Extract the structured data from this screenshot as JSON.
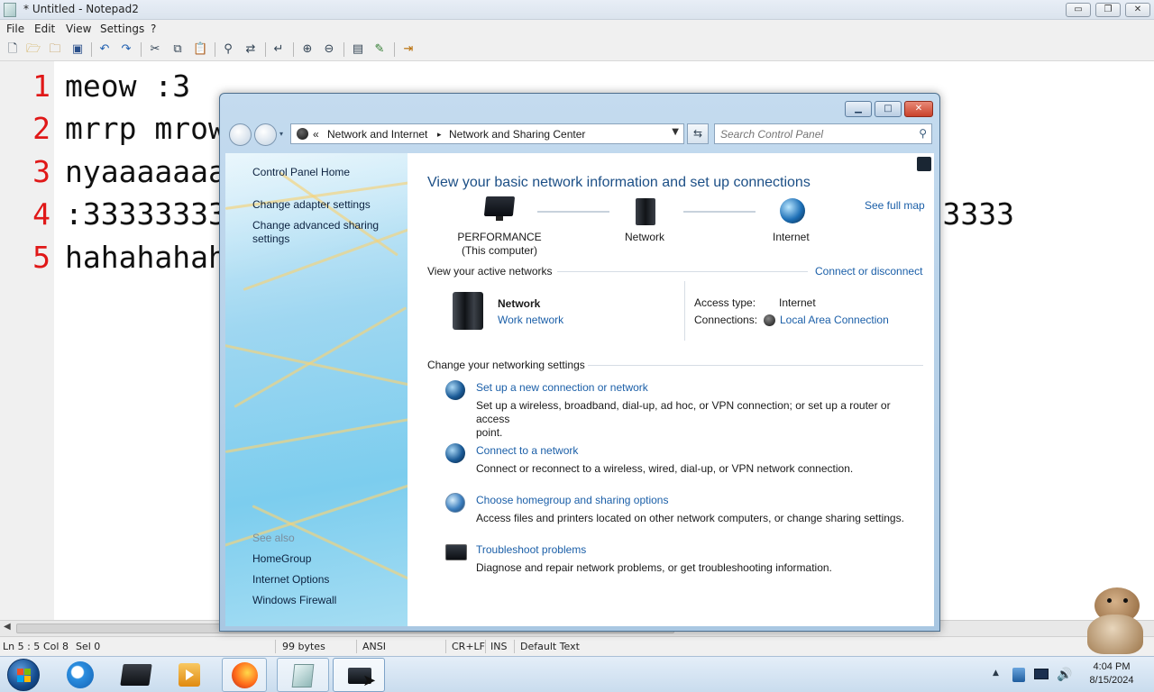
{
  "notepad": {
    "title": "* Untitled - Notepad2",
    "window_buttons": [
      "▭",
      "❐",
      "✕"
    ],
    "menu": [
      "File",
      "Edit",
      "View",
      "Settings",
      "?"
    ],
    "line_numbers": [
      "1",
      "2",
      "3",
      "4",
      "5"
    ],
    "lines": [
      "meow :3",
      "mrrp mrow",
      "nyaaaaaaaaaaa",
      ":3333333333333333333333333333333333333333333333333333",
      "hahahahahaha"
    ],
    "status": {
      "position": "Ln 5 : 5",
      "col": "Col 8",
      "sel": "Sel 0",
      "size": "99 bytes",
      "encoding": "ANSI",
      "eol": "CR+LF",
      "ins": "INS",
      "scheme": "Default Text"
    }
  },
  "control_panel": {
    "breadcrumb": {
      "chevrons": "«",
      "item1": "Network and Internet",
      "sep": "▸",
      "item2": "Network and Sharing Center"
    },
    "search_placeholder": "Search Control Panel",
    "left": {
      "home": "Control Panel Home",
      "adapter": "Change adapter settings",
      "advanced_line1": "Change advanced sharing",
      "advanced_line2": "settings",
      "see_also": "See also",
      "homegroup": "HomeGroup",
      "internet_options": "Internet Options",
      "firewall": "Windows Firewall"
    },
    "main": {
      "heading": "View your basic network information and set up connections",
      "see_full_map": "See full map",
      "map": {
        "computer_line1": "PERFORMANCE",
        "computer_line2": "(This computer)",
        "network": "Network",
        "internet": "Internet"
      },
      "active_networks_label": "View your active networks",
      "connect_or_disconnect": "Connect or disconnect",
      "active": {
        "name": "Network",
        "type": "Work network",
        "access_label": "Access type:",
        "access_value": "Internet",
        "connections_label": "Connections:",
        "connections_value": "Local Area Connection"
      },
      "change_label": "Change your networking settings",
      "tasks": [
        {
          "title": "Set up a new connection or network",
          "desc1": "Set up a wireless, broadband, dial-up, ad hoc, or VPN connection; or set up a router or access",
          "desc2": "point."
        },
        {
          "title": "Connect to a network",
          "desc1": "Connect or reconnect to a wireless, wired, dial-up, or VPN network connection."
        },
        {
          "title": "Choose homegroup and sharing options",
          "desc1": "Access files and printers located on other network computers, or change sharing settings."
        },
        {
          "title": "Troubleshoot problems",
          "desc1": "Diagnose and repair network problems, or get troubleshooting information."
        }
      ]
    }
  },
  "taskbar": {
    "clock_time": "4:04 PM",
    "clock_date": "8/15/2024",
    "tray_arrow": "▲"
  }
}
